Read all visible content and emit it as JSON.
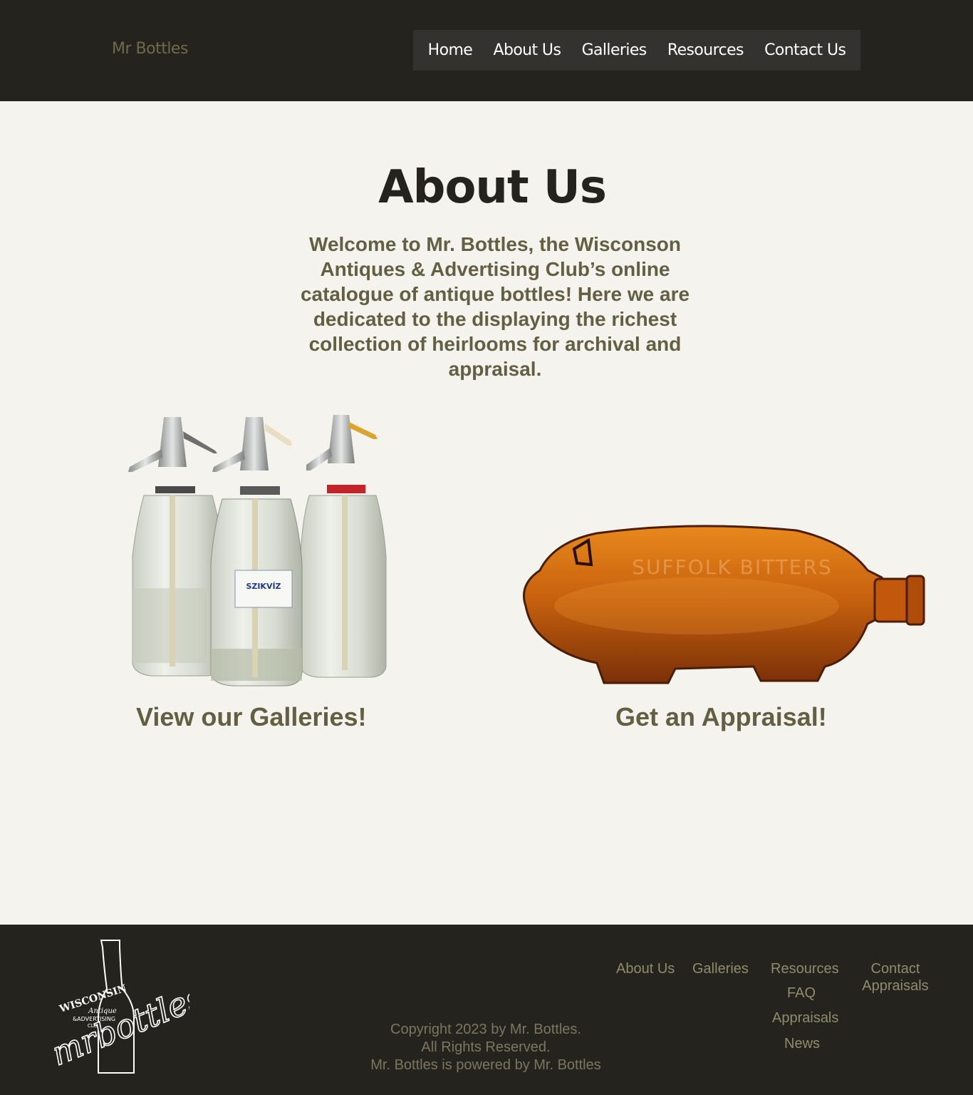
{
  "header": {
    "brand": "Mr Bottles",
    "nav": [
      "Home",
      "About Us",
      "Galleries",
      "Resources",
      "Contact Us"
    ]
  },
  "main": {
    "title": "About Us",
    "intro": "Welcome to Mr. Bottles, the Wisconson Antiques & Advertising Club’s online catalogue of antique bottles! Here we are dedicated to the displaying the richest collection of heirlooms for archival and appraisal.",
    "cards": [
      {
        "label": "View our Galleries!",
        "image": "seltzer-bottles-icon"
      },
      {
        "label": "Get an Appraisal!",
        "image": "pig-bottle-icon",
        "bottle_text": "SUFFOLK BITTERS"
      }
    ]
  },
  "footer": {
    "logo": {
      "line1": "WISCONSIN",
      "line2": "Antique",
      "line3": "&ADVERTISING",
      "line4": "CLUB",
      "script": "mrbottles"
    },
    "copyright": [
      "Copyright 2023 by Mr. Bottles.",
      "All Rights Reserved.",
      "Mr. Bottles is powered by Mr. Bottles"
    ],
    "nav": {
      "about": "About Us",
      "galleries": "Galleries",
      "resources": "Resources",
      "faq": "FAQ",
      "appraisals": "Appraisals",
      "news": "News",
      "contact": "Contact",
      "contact_appraisals": "Appraisals"
    }
  },
  "colors": {
    "dark": "#25231d",
    "olive": "#625f42",
    "background": "#f5f3ed",
    "amber": "#c8620e"
  }
}
